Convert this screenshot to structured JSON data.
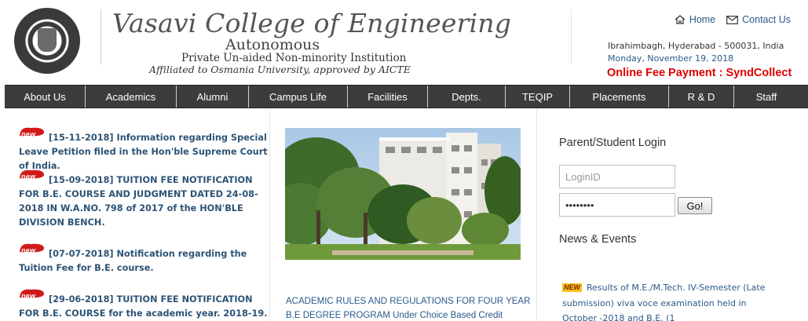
{
  "header": {
    "college_name": "Vasavi College of Engineering",
    "autonomous": "Autonomous",
    "institution": "Private Un-aided Non-minority Institution",
    "affiliation": "Affiliated to Osmania University, approved by AICTE",
    "home_label": "Home",
    "contact_label": "Contact Us",
    "address": "Ibrahimbagh, Hyderabad - 500031, India",
    "date": "Monday, November 19, 2018",
    "fee_payment": "Online Fee Payment : SyndCollect"
  },
  "nav": {
    "items": [
      "About Us",
      "Academics",
      "Alumni",
      "Campus Life",
      "Facilities",
      "Depts.",
      "TEQIP",
      "Placements",
      "R & D",
      "Staff"
    ]
  },
  "news": {
    "badge": "new",
    "items": [
      "[15-11-2018] Information regarding Special Leave Petition filed in the Hon'ble Supreme Court of India.",
      "[15-09-2018] TUITION FEE NOTIFICATION FOR B.E. COURSE AND JUDGMENT DATED 24-08-2018 IN W.A.NO. 798 of 2017 of the HON'BLE DIVISION BENCH.",
      "[07-07-2018] Notification regarding the Tuition Fee for B.E. course.",
      "[29-06-2018] TUITION FEE NOTIFICATION FOR B.E. COURSE for the academic year. 2018-19."
    ]
  },
  "center": {
    "caption": "ACADEMIC RULES AND REGULATIONS FOR FOUR YEAR B.E DEGREE PROGRAM Under Choice Based Credit System"
  },
  "login": {
    "title": "Parent/Student Login",
    "login_placeholder": "LoginID",
    "password_value": "password",
    "go_label": "Go!"
  },
  "events": {
    "title": "News & Events",
    "new_tag": "NEW",
    "item": "Results of M.E./M.Tech. IV-Semester (Late submission) viva voce examination held in October -2018 and B.E. (1"
  },
  "colors": {
    "nav_bg": "#3c3c3c",
    "link": "#2a5a8a",
    "news_link": "#2d5476",
    "fee": "#e00000",
    "badge": "#d11a1a"
  }
}
